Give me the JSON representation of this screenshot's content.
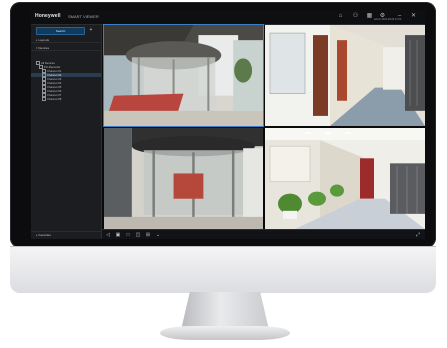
{
  "app": {
    "brand": "Honeywell",
    "name": "SMART VIEWER",
    "titlebar_icons": [
      "home-icon",
      "user-icon",
      "grid-icon",
      "settings-icon",
      "minimize-icon",
      "close-icon"
    ],
    "titlebar_glyphs": [
      "⌂",
      "⚇",
      "▦",
      "⚙",
      "–",
      "✕"
    ],
    "user_line": "admin  2019-08-06 10:00"
  },
  "sidebar": {
    "search_label": "Search",
    "add_glyph": "+",
    "sections": [
      {
        "label": "Layouts"
      },
      {
        "label": "Devices"
      }
    ],
    "tree": [
      {
        "label": "All Devices",
        "level": 1
      },
      {
        "label": "PU-Recorder",
        "level": 2
      },
      {
        "label": "Channel 01",
        "level": 3
      },
      {
        "label": "Channel 02",
        "level": 3,
        "selected": true
      },
      {
        "label": "Channel 03",
        "level": 3
      },
      {
        "label": "Channel 04",
        "level": 3
      },
      {
        "label": "Channel 05",
        "level": 3
      },
      {
        "label": "Channel 06",
        "level": 3
      },
      {
        "label": "Channel 07",
        "level": 3
      },
      {
        "label": "Channel 08",
        "level": 3
      }
    ],
    "footer_label": "Favorites"
  },
  "toolbar": {
    "icons": [
      "back-icon",
      "snapshot-icon",
      "layout-1x1-icon",
      "layout-2x2-icon",
      "layout-3x3-icon",
      "more-icon"
    ],
    "glyphs": [
      "◁",
      "▣",
      "□",
      "◫",
      "⊞",
      "⌄"
    ],
    "fullscreen_glyph": "⤢"
  },
  "colors": {
    "accent": "#3b7fc4",
    "screen_bg": "#16171a",
    "sidebar_bg": "#1c1d21"
  }
}
